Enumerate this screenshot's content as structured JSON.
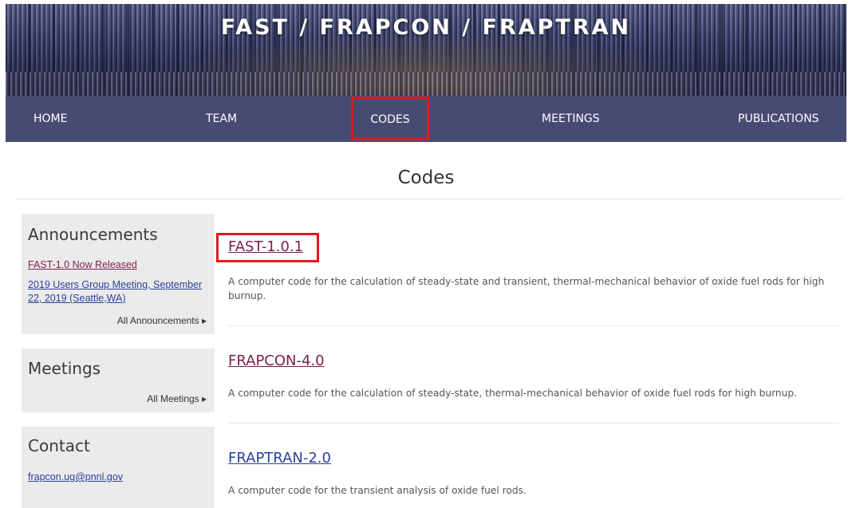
{
  "banner": {
    "title": "FAST / FRAPCON / FRAPTRAN"
  },
  "nav": {
    "items": [
      {
        "label": "HOME"
      },
      {
        "label": "TEAM"
      },
      {
        "label": "CODES",
        "highlighted": true
      },
      {
        "label": "MEETINGS"
      },
      {
        "label": "PUBLICATIONS"
      }
    ]
  },
  "page": {
    "title": "Codes"
  },
  "sidebar": {
    "announcements": {
      "heading": "Announcements",
      "links": [
        {
          "text": "FAST-1.0 Now Released"
        },
        {
          "text": "2019 Users Group Meeting, September 22, 2019 (Seattle,WA)"
        }
      ],
      "more": "All Announcements ▸"
    },
    "meetings": {
      "heading": "Meetings",
      "more": "All Meetings ▸"
    },
    "contact": {
      "heading": "Contact",
      "email": "frapcon.ug@pnnl.gov"
    }
  },
  "codes": [
    {
      "name": "FAST-1.0.1",
      "description": "A computer code for the calculation of steady-state and transient, thermal-mechanical behavior of oxide fuel rods for high burnup.",
      "highlighted": true
    },
    {
      "name": "FRAPCON-4.0",
      "description": "A computer code for the calculation of steady-state, thermal-mechanical behavior of oxide fuel rods for high burnup."
    },
    {
      "name": "FRAPTRAN-2.0",
      "description": "A computer code for the transient analysis of oxide fuel rods."
    }
  ],
  "colors": {
    "nav_bg": "#474a72",
    "highlight": "#e0191f",
    "visited_link": "#7b1f4a",
    "link": "#2a3f9e"
  }
}
